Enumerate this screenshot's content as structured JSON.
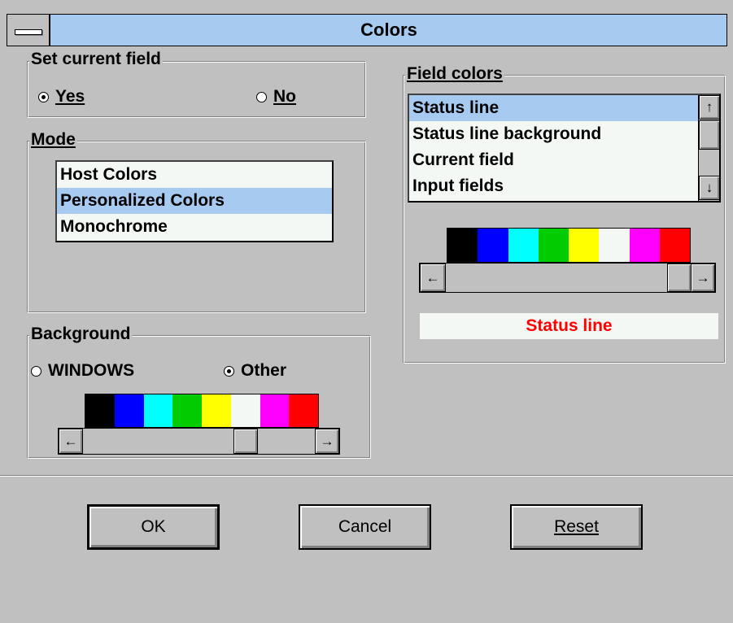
{
  "window": {
    "title": "Colors"
  },
  "set_current_field": {
    "legend": "Set current field",
    "options": [
      {
        "label": "Yes",
        "selected": true
      },
      {
        "label": "No",
        "selected": false
      }
    ]
  },
  "mode": {
    "legend": "Mode",
    "items": [
      "Host Colors",
      "Personalized Colors",
      "Monochrome"
    ],
    "selected": "Personalized Colors"
  },
  "background": {
    "legend": "Background",
    "options": [
      {
        "label": "WINDOWS",
        "selected": false
      },
      {
        "label": "Other",
        "selected": true
      }
    ],
    "palette": [
      "#000000",
      "#0000ff",
      "#00ffff",
      "#00cc00",
      "#ffff00",
      "#f4f8f4",
      "#ff00ff",
      "#ff0000"
    ]
  },
  "field_colors": {
    "legend": "Field colors",
    "items": [
      "Status line",
      "Status line background",
      "Current field",
      "Input fields"
    ],
    "selected": "Status line",
    "palette": [
      "#000000",
      "#0000ff",
      "#00ffff",
      "#00cc00",
      "#ffff00",
      "#f4f8f4",
      "#ff00ff",
      "#ff0000"
    ],
    "preview_text": "Status line",
    "preview_color": "#ff0000"
  },
  "buttons": {
    "ok": "OK",
    "cancel": "Cancel",
    "reset": "Reset"
  },
  "icons": {
    "system_menu": "system-menu-icon",
    "arrow_up": "↑",
    "arrow_down": "↓",
    "arrow_left": "←",
    "arrow_right": "→"
  }
}
